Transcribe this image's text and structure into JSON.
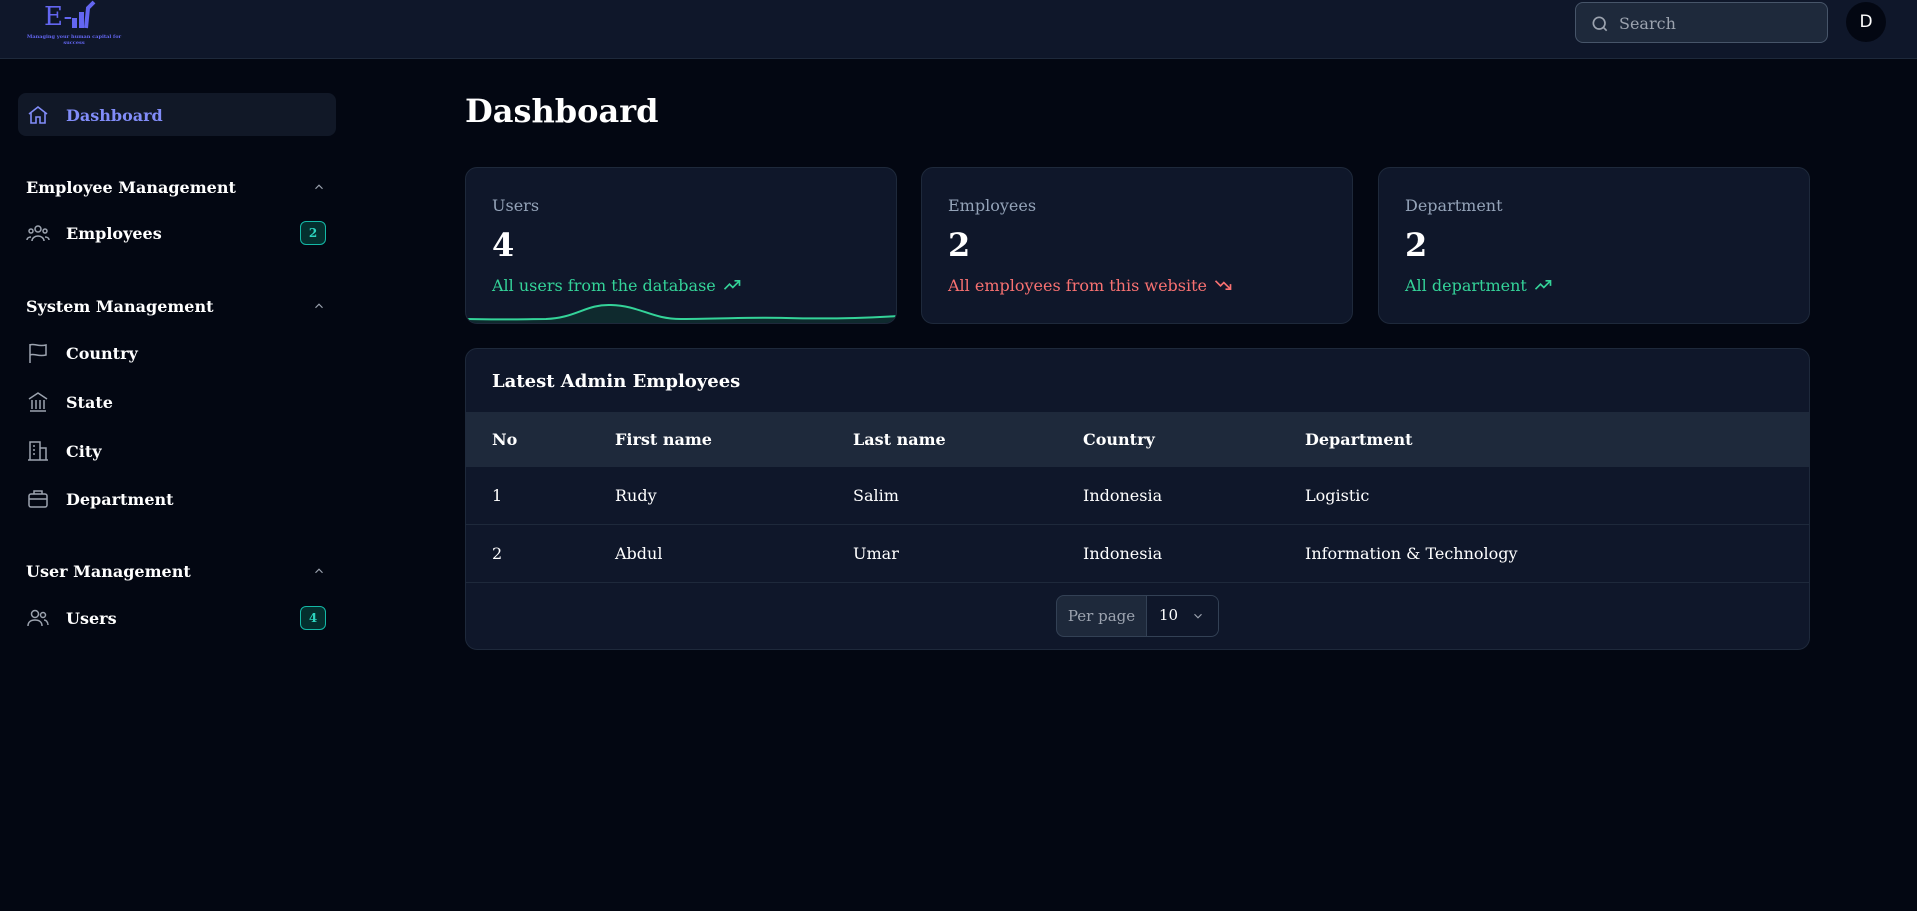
{
  "header": {
    "logo_text": "E-",
    "logo_tagline": "Managing your human capital for success",
    "search_placeholder": "Search",
    "avatar_initial": "D"
  },
  "sidebar": {
    "dashboard_label": "Dashboard",
    "groups": [
      {
        "title": "Employee Management",
        "items": [
          {
            "label": "Employees",
            "icon": "users-group-icon",
            "badge": "2"
          }
        ]
      },
      {
        "title": "System Management",
        "items": [
          {
            "label": "Country",
            "icon": "flag-icon"
          },
          {
            "label": "State",
            "icon": "building-columns-icon"
          },
          {
            "label": "City",
            "icon": "office-building-icon"
          },
          {
            "label": "Department",
            "icon": "briefcase-icon"
          }
        ]
      },
      {
        "title": "User Management",
        "items": [
          {
            "label": "Users",
            "icon": "users-icon",
            "badge": "4"
          }
        ]
      }
    ]
  },
  "main": {
    "title": "Dashboard",
    "stats": [
      {
        "label": "Users",
        "value": "4",
        "description": "All users from the database",
        "trend": "up",
        "color": "#34d399"
      },
      {
        "label": "Employees",
        "value": "2",
        "description": "All employees from this website",
        "trend": "down",
        "color": "#f87171"
      },
      {
        "label": "Department",
        "value": "2",
        "description": "All department",
        "trend": "up",
        "color": "#34d399"
      }
    ],
    "table": {
      "title": "Latest Admin Employees",
      "columns": [
        "No",
        "First name",
        "Last name",
        "Country",
        "Department"
      ],
      "rows": [
        [
          "1",
          "Rudy",
          "Salim",
          "Indonesia",
          "Logistic"
        ],
        [
          "2",
          "Abdul",
          "Umar",
          "Indonesia",
          "Information & Technology"
        ]
      ],
      "per_page_label": "Per page",
      "per_page_value": "10"
    }
  },
  "colors": {
    "accent": "#818cf8",
    "success": "#34d399",
    "danger": "#f87171",
    "badge": "#2dd4bf"
  }
}
